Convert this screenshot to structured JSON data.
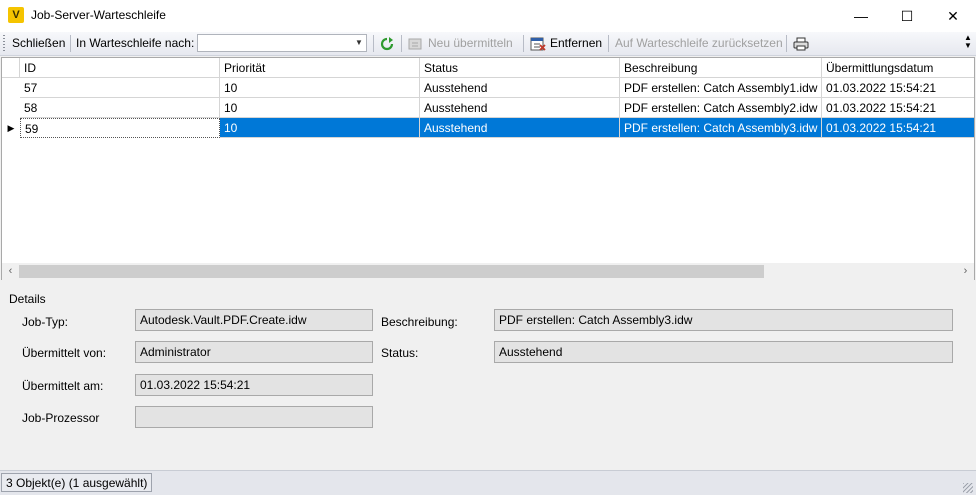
{
  "window": {
    "title": "Job-Server-Warteschleife",
    "app_icon_letter": "V",
    "minimize_glyph": "—",
    "maximize_glyph": "☐",
    "close_glyph": "✕"
  },
  "toolbar": {
    "close_label": "Schließen",
    "queue_label": "In Warteschleife nach:",
    "queue_value": "",
    "resubmit_label": "Neu übermitteln",
    "remove_label": "Entfernen",
    "reset_label": "Auf Warteschleife zurücksetzen",
    "icons": [
      "refresh-icon",
      "resubmit-icon",
      "remove-icon",
      "print-icon"
    ]
  },
  "grid": {
    "columns": [
      "ID",
      "Priorität",
      "Status",
      "Beschreibung",
      "Übermittlungsdatum"
    ],
    "rows": [
      {
        "id": "57",
        "priority": "10",
        "status": "Ausstehend",
        "description": "PDF erstellen: Catch Assembly1.idw",
        "date": "01.03.2022 15:54:21"
      },
      {
        "id": "58",
        "priority": "10",
        "status": "Ausstehend",
        "description": "PDF erstellen: Catch Assembly2.idw",
        "date": "01.03.2022 15:54:21"
      },
      {
        "id": "59",
        "priority": "10",
        "status": "Ausstehend",
        "description": "PDF erstellen: Catch Assembly3.idw",
        "date": "01.03.2022 15:54:21"
      }
    ],
    "selected_row": 2
  },
  "details": {
    "legend": "Details",
    "job_type_label": "Job-Typ:",
    "job_type_value": "Autodesk.Vault.PDF.Create.idw",
    "submitted_by_label": "Übermittelt von:",
    "submitted_by_value": "Administrator",
    "submitted_at_label": "Übermittelt am:",
    "submitted_at_value": "01.03.2022 15:54:21",
    "processor_label": "Job-Prozessor",
    "processor_value": "",
    "description_label": "Beschreibung:",
    "description_value": "PDF erstellen: Catch Assembly3.idw",
    "status_label": "Status:",
    "status_value": "Ausstehend"
  },
  "statusbar": {
    "text": "3 Objekt(e) (1 ausgewählt)"
  },
  "colors": {
    "selection": "#0078d7",
    "refresh_icon": "#2e9a2e",
    "remove_icon": "#c0392b"
  }
}
